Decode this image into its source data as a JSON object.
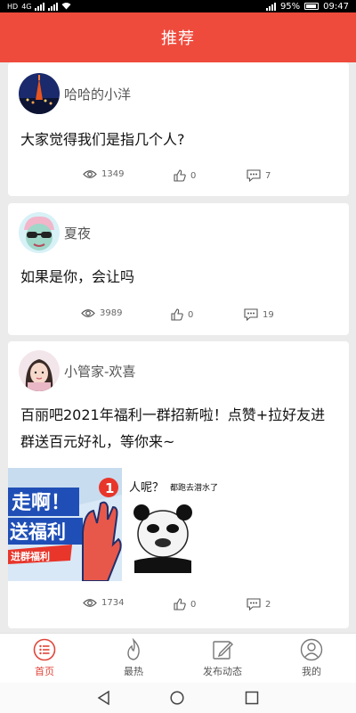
{
  "status_bar": {
    "left_text": "HD",
    "left_sub": "4G",
    "battery": "95%",
    "time": "09:47"
  },
  "header": {
    "title": "推荐"
  },
  "posts": [
    {
      "username": "哈哈的小洋",
      "content": "大家觉得我们是指几个人?",
      "views": "1349",
      "likes": "0",
      "comments": "7"
    },
    {
      "username": "夏夜",
      "content": "如果是你，会让吗",
      "views": "3989",
      "likes": "0",
      "comments": "19"
    },
    {
      "username": "小管家-欢喜",
      "content": "百丽吧2021年福利一群招新啦！点赞+拉好友进群送百元好礼，等你来~",
      "views": "1734",
      "likes": "0",
      "comments": "2",
      "image1": {
        "line1": "走啊！",
        "line2": "送福利",
        "banner": "进群福利",
        "badge": "1"
      },
      "image2": {
        "caption_big": "人呢？",
        "caption_small": "都跑去潜水了"
      }
    }
  ],
  "tabs": [
    {
      "label": "首页",
      "icon": "home-list-icon",
      "active": true
    },
    {
      "label": "最热",
      "icon": "flame-icon",
      "active": false
    },
    {
      "label": "发布动态",
      "icon": "edit-icon",
      "active": false
    },
    {
      "label": "我的",
      "icon": "user-icon",
      "active": false
    }
  ],
  "colors": {
    "accent": "#ef4b3d",
    "tab_active": "#e0453a",
    "background": "#ebebeb"
  }
}
